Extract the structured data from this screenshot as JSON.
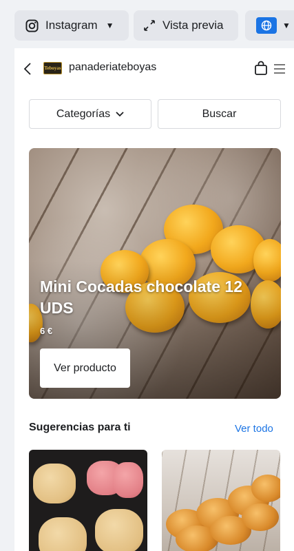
{
  "toolbar": {
    "platform_label": "Instagram",
    "preview_label": "Vista previa"
  },
  "shop": {
    "logo_text": "Teboyas",
    "name": "panaderiateboyas",
    "categories_label": "Categorías",
    "search_label": "Buscar"
  },
  "hero": {
    "title": "Mini Cocadas chocolate 12 UDS",
    "price": "6 €",
    "cta_label": "Ver producto"
  },
  "suggestions": {
    "title": "Sugerencias para ti",
    "see_all_label": "Ver todo"
  },
  "colors": {
    "accent": "#1b74e4",
    "background": "#f0f2f5",
    "toolbar_button": "#e4e6eb"
  },
  "icons": [
    "instagram-icon",
    "caret-down-icon",
    "expand-icon",
    "globe-icon",
    "back-icon",
    "shopping-bag-icon",
    "menu-icon",
    "chevron-down-icon"
  ]
}
